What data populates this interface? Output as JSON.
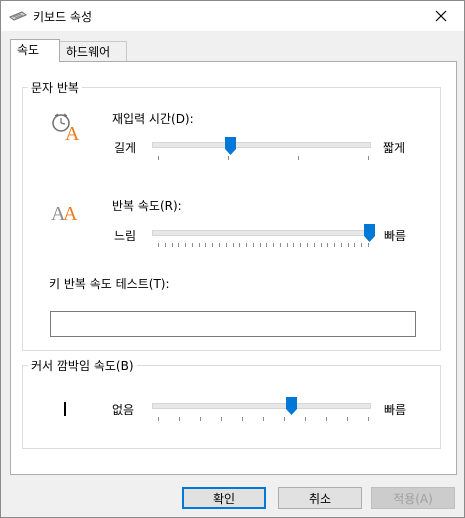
{
  "window": {
    "title": "키보드 속성",
    "close_icon": "close-icon",
    "app_icon": "keyboard-icon"
  },
  "tabs": [
    {
      "label": "속도",
      "active": true
    },
    {
      "label": "하드웨어",
      "active": false
    }
  ],
  "repeat_group": {
    "title": "문자 반복",
    "delay": {
      "label": "재입력 시간(D):",
      "min_label": "길게",
      "max_label": "짧게",
      "level": 0.34,
      "tick_count": 4,
      "icon": "repeat-delay-icon"
    },
    "rate": {
      "label": "반복 속도(R):",
      "min_label": "느림",
      "max_label": "빠름",
      "level": 1.0,
      "tick_count": 32,
      "icon": "repeat-rate-icon"
    },
    "test_label": "키 반복 속도 테스트(T):",
    "test_value": ""
  },
  "cursor_group": {
    "title": "커서 깜박임 속도(B)",
    "min_label": "없음",
    "max_label": "빠름",
    "level": 0.63,
    "tick_count": 11,
    "icon": "cursor-blink-icon"
  },
  "buttons": {
    "ok": "확인",
    "cancel": "취소",
    "apply": "적용(A)"
  },
  "colors": {
    "accent": "#0078d7",
    "letter_orange": "#f07a1a",
    "letter_gray": "#8c8c8c"
  }
}
